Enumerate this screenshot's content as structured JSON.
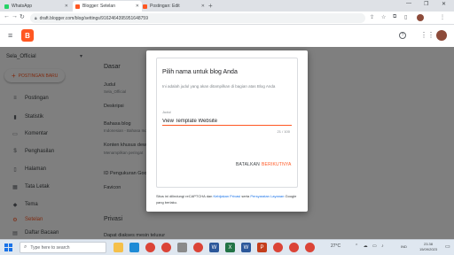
{
  "browser": {
    "tabs": [
      {
        "title": "WhatsApp",
        "color": "#25d366"
      },
      {
        "title": "Blogger: Setelan",
        "color": "#ff5722"
      },
      {
        "title": "Postingan: Edit",
        "color": "#ff5722"
      }
    ],
    "url": "draft.blogger.com/blog/settings/9162464395951648759"
  },
  "header": {
    "logo_letter": "B"
  },
  "sidebar": {
    "blog_name": "Sela_Official",
    "new_post": "POSTINGAN BARU",
    "items": [
      {
        "label": "Postingan",
        "icon": "≡"
      },
      {
        "label": "Statistik",
        "icon": "▮"
      },
      {
        "label": "Komentar",
        "icon": "▭"
      },
      {
        "label": "Penghasilan",
        "icon": "$"
      },
      {
        "label": "Halaman",
        "icon": "▯"
      },
      {
        "label": "Tata Letak",
        "icon": "▦"
      },
      {
        "label": "Tema",
        "icon": "◆"
      },
      {
        "label": "Setelan",
        "icon": "⚙"
      },
      {
        "label": "Daftar Bacaan",
        "icon": "▤"
      }
    ]
  },
  "settings": {
    "section_basic": "Dasar",
    "title_label": "Judul",
    "title_value": "Sela_Official",
    "desc_label": "Deskripsi",
    "lang_label": "Bahasa blog",
    "lang_value": "Indonesian - Bahasa Indonesia",
    "content_label": "Konten khusus dewa",
    "content_value": "Menampilkan peringat",
    "id_label": "ID Pengukuran Goo",
    "favicon_label": "Favicon",
    "section_privacy": "Privasi",
    "privacy_item": "Dapat diakses mesin telusur"
  },
  "dialog": {
    "title": "Pilih nama untuk blog Anda",
    "description": "Ini adalah judul yang akan ditampilkan di bagian atas Blog Anda",
    "field_label": "Judul",
    "input_value": "View Template Website",
    "char_count": "21 / 100",
    "cancel": "BATALKAN",
    "save": "BERIKUTNYA",
    "footer_pre": "Situs ini dilindungi reCAPTCHA dan",
    "privacy_link": "Kebijakan Privasi",
    "footer_mid": "serta",
    "terms_link": "Persyaratan Layanan",
    "footer_post": "Google yang berlaku."
  },
  "taskbar": {
    "search_placeholder": "Type here to search",
    "apps": [
      {
        "icon": "folder-icon",
        "color": "#f5c04a"
      },
      {
        "icon": "edge-icon",
        "color": "#1e8bd6"
      },
      {
        "icon": "chrome-icon",
        "color": "#db4437"
      },
      {
        "icon": "word-icon",
        "color": "#2b579a"
      },
      {
        "icon": "excel-icon",
        "color": "#217346"
      }
    ],
    "weather": "27°C",
    "lang": "IND",
    "time": "23.38",
    "date": "15/09/2023"
  },
  "colors": {
    "accent": "#ff5722",
    "link": "#1a73e8"
  }
}
